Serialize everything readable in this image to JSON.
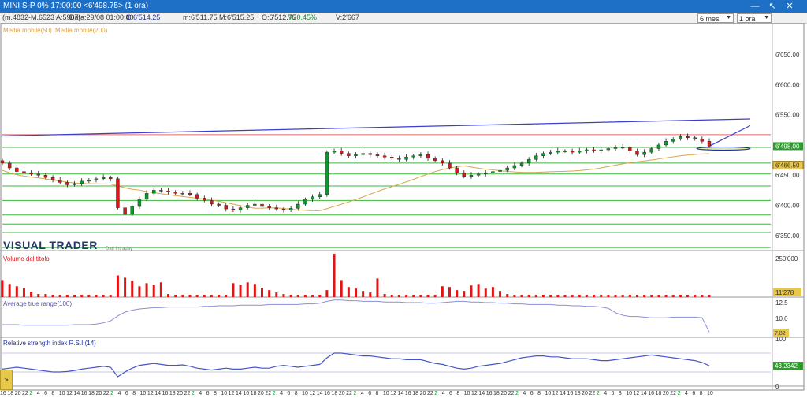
{
  "window": {
    "title": "MINI S-P 0% 17:00:00   <6'498.75>   (1 ora)",
    "minimize_icon": "minimize-icon",
    "maximize_icon": "maximize-icon",
    "close_icon": "close-icon"
  },
  "infobar": {
    "range": "(m.4832-M.6523 A:5967)",
    "date": "Data:29/08 01:00:00",
    "close": "C:6'514.25",
    "min": "m:6'511.75",
    "max": "M:6'515.25",
    "open": "O:6'512.75",
    "pct": "%:0.45%",
    "volume": "V:2'667",
    "period_select": "6 mesi",
    "interval_select": "1 ora"
  },
  "legend": {
    "ma50": "Media mobile(50)",
    "ma200": "Media mobile(200)"
  },
  "logo": {
    "name": "VISUAL TRADER",
    "subtitle": "Dati Intraday"
  },
  "panels": {
    "volume_title": "Volume del titolo",
    "atr_title": "Average true range(100)",
    "rsi_title": "Relative strength index R.S.I.(14)"
  },
  "left_tab": ">",
  "colors": {
    "titlebar": "#1e6fc6",
    "up_candle": "#0a9a2a",
    "down_candle": "#d11a1a",
    "volume_bar": "#e01414",
    "ma50": "#d9a54e",
    "trendline": "#3b3fcf",
    "hline": "#3fb53f",
    "atr_line": "#8b8fd6",
    "rsi_line": "#4455c8"
  },
  "chart_data": [
    {
      "type": "candlestick",
      "panel": "price",
      "y_ticks": [
        "6'650.00",
        "6'600.00",
        "6'550.00",
        "6'450.00",
        "6'400.00",
        "6'350.00"
      ],
      "ylim": [
        6325,
        6680
      ],
      "current_price": "6'498.00",
      "highlight_price_label": "6'466.50",
      "horizontal_levels": [
        6517,
        6496,
        6470,
        6452,
        6432,
        6408,
        6384,
        6369,
        6355,
        6330
      ],
      "close": [
        6470,
        6462,
        6456,
        6454,
        6452,
        6450,
        6446,
        6442,
        6438,
        6434,
        6436,
        6440,
        6442,
        6444,
        6446,
        6444,
        6396,
        6385,
        6398,
        6410,
        6420,
        6425,
        6424,
        6422,
        6420,
        6420,
        6418,
        6412,
        6408,
        6402,
        6400,
        6394,
        6392,
        6396,
        6400,
        6402,
        6398,
        6396,
        6394,
        6392,
        6395,
        6402,
        6410,
        6414,
        6418,
        6488,
        6490,
        6486,
        6482,
        6484,
        6486,
        6484,
        6482,
        6480,
        6478,
        6476,
        6480,
        6482,
        6484,
        6478,
        6474,
        6470,
        6462,
        6454,
        6448,
        6450,
        6452,
        6454,
        6456,
        6458,
        6462,
        6466,
        6470,
        6476,
        6482,
        6486,
        6488,
        6490,
        6490,
        6488,
        6490,
        6492,
        6490,
        6492,
        6494,
        6496,
        6496,
        6490,
        6484,
        6488,
        6494,
        6500,
        6506,
        6510,
        6514,
        6512,
        6510,
        6506,
        6498
      ],
      "x_tick_labels": [
        "16",
        "18",
        "20",
        "22",
        "2",
        "4",
        "6",
        "8",
        "10",
        "12",
        "14",
        "16",
        "18",
        "20",
        "22",
        "2",
        "4",
        "6",
        "8",
        "10",
        "12",
        "14",
        "16",
        "18",
        "20",
        "22",
        "2",
        "4",
        "6",
        "8",
        "10",
        "12",
        "14",
        "16",
        "18",
        "20",
        "22",
        "2",
        "4",
        "6",
        "8",
        "10",
        "12",
        "14",
        "16",
        "18",
        "20",
        "22",
        "2",
        "4",
        "6",
        "8",
        "10",
        "12",
        "14",
        "16",
        "18",
        "20",
        "22",
        "2",
        "4",
        "6",
        "8",
        "10",
        "12",
        "14",
        "16",
        "18",
        "20",
        "22",
        "2",
        "4",
        "6",
        "8",
        "10",
        "12",
        "14",
        "16",
        "18",
        "20",
        "22",
        "2",
        "4",
        "6",
        "8",
        "10",
        "12",
        "14",
        "16",
        "18",
        "20",
        "22",
        "2",
        "4",
        "6",
        "8",
        "10"
      ]
    },
    {
      "type": "bar",
      "panel": "volume",
      "title": "Volume del titolo",
      "y_ticks": [
        "250'000"
      ],
      "ylim": [
        0,
        280000
      ],
      "last_value_label": "11'278",
      "values": [
        110000,
        85000,
        70000,
        60000,
        35000,
        20000,
        20000,
        15000,
        15000,
        15000,
        15000,
        15000,
        15000,
        15000,
        15000,
        15000,
        140000,
        125000,
        105000,
        70000,
        90000,
        80000,
        95000,
        20000,
        15000,
        15000,
        15000,
        15000,
        15000,
        15000,
        15000,
        15000,
        90000,
        80000,
        95000,
        85000,
        60000,
        45000,
        30000,
        20000,
        15000,
        15000,
        15000,
        15000,
        15000,
        45000,
        280000,
        110000,
        65000,
        55000,
        40000,
        30000,
        120000,
        20000,
        15000,
        15000,
        15000,
        15000,
        15000,
        15000,
        15000,
        70000,
        65000,
        45000,
        40000,
        75000,
        85000,
        55000,
        65000,
        40000,
        20000,
        15000,
        15000,
        15000,
        15000,
        15000,
        15000,
        15000,
        15000,
        15000,
        15000,
        15000,
        15000,
        15000,
        15000,
        15000,
        15000,
        15000,
        15000,
        15000,
        15000,
        15000,
        15000,
        15000,
        15000,
        15000,
        15000,
        15000,
        15000
      ]
    },
    {
      "type": "line",
      "panel": "atr",
      "title": "Average true range(100)",
      "y_ticks": [
        "12.5",
        "10.0"
      ],
      "ylim": [
        7.0,
        13.0
      ],
      "last_value_label": "7.82",
      "values": [
        9.0,
        9.0,
        9.0,
        8.9,
        8.9,
        8.9,
        8.9,
        8.9,
        8.9,
        8.9,
        9.0,
        9.0,
        9.0,
        9.1,
        9.3,
        9.6,
        10.4,
        11.0,
        11.3,
        11.5,
        11.6,
        11.7,
        11.7,
        11.8,
        11.8,
        11.8,
        11.8,
        11.8,
        11.9,
        11.9,
        12.0,
        12.0,
        12.0,
        12.1,
        12.1,
        12.1,
        12.1,
        12.2,
        12.2,
        12.2,
        12.2,
        12.2,
        12.3,
        12.3,
        12.4,
        12.7,
        12.9,
        12.9,
        12.8,
        12.8,
        12.7,
        12.7,
        12.7,
        12.6,
        12.6,
        12.6,
        12.5,
        12.5,
        12.5,
        12.4,
        12.4,
        12.5,
        12.6,
        12.7,
        12.7,
        12.6,
        12.6,
        12.5,
        12.5,
        12.4,
        12.4,
        12.3,
        12.3,
        12.2,
        12.2,
        12.2,
        12.2,
        12.1,
        12.1,
        12.0,
        12.0,
        11.9,
        11.9,
        11.8,
        11.6,
        10.9,
        10.5,
        10.3,
        10.3,
        10.2,
        10.1,
        10.1,
        10.1,
        10.2,
        10.2,
        10.2,
        10.2,
        10.1,
        7.82
      ]
    },
    {
      "type": "line",
      "panel": "rsi",
      "title": "Relative strength index R.S.I.(14)",
      "y_ticks": [
        "100",
        "0"
      ],
      "ylim": [
        0,
        100
      ],
      "last_value_label": "43.2342",
      "values": [
        36,
        38,
        40,
        38,
        36,
        34,
        32,
        30,
        30,
        31,
        33,
        36,
        38,
        40,
        42,
        40,
        20,
        30,
        38,
        44,
        46,
        48,
        46,
        44,
        44,
        45,
        42,
        38,
        36,
        34,
        36,
        38,
        36,
        36,
        38,
        40,
        38,
        38,
        42,
        44,
        42,
        40,
        42,
        44,
        46,
        60,
        70,
        70,
        68,
        66,
        64,
        64,
        62,
        60,
        58,
        58,
        56,
        56,
        56,
        52,
        48,
        46,
        42,
        38,
        36,
        38,
        42,
        44,
        46,
        48,
        52,
        56,
        60,
        62,
        64,
        64,
        62,
        62,
        60,
        58,
        58,
        58,
        56,
        54,
        54,
        56,
        58,
        60,
        62,
        64,
        66,
        64,
        62,
        60,
        58,
        56,
        54,
        50,
        43.2342
      ]
    }
  ]
}
